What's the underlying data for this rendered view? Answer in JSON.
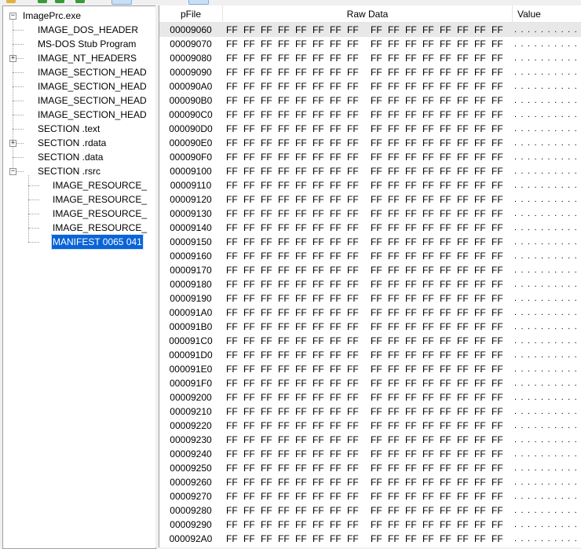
{
  "tree": {
    "root_label": "ImagePrc.exe",
    "nodes": [
      {
        "label": "IMAGE_DOS_HEADER",
        "level": 1,
        "expander": ""
      },
      {
        "label": "MS-DOS Stub Program",
        "level": 1,
        "expander": ""
      },
      {
        "label": "IMAGE_NT_HEADERS",
        "level": 1,
        "expander": "+"
      },
      {
        "label": "IMAGE_SECTION_HEAD",
        "level": 1,
        "expander": ""
      },
      {
        "label": "IMAGE_SECTION_HEAD",
        "level": 1,
        "expander": ""
      },
      {
        "label": "IMAGE_SECTION_HEAD",
        "level": 1,
        "expander": ""
      },
      {
        "label": "IMAGE_SECTION_HEAD",
        "level": 1,
        "expander": ""
      },
      {
        "label": "SECTION .text",
        "level": 1,
        "expander": ""
      },
      {
        "label": "SECTION .rdata",
        "level": 1,
        "expander": "+"
      },
      {
        "label": "SECTION .data",
        "level": 1,
        "expander": ""
      },
      {
        "label": "SECTION .rsrc",
        "level": 1,
        "expander": "-"
      },
      {
        "label": "IMAGE_RESOURCE_",
        "level": 2,
        "expander": ""
      },
      {
        "label": "IMAGE_RESOURCE_",
        "level": 2,
        "expander": ""
      },
      {
        "label": "IMAGE_RESOURCE_",
        "level": 2,
        "expander": ""
      },
      {
        "label": "IMAGE_RESOURCE_",
        "level": 2,
        "expander": ""
      },
      {
        "label": "MANIFEST  0065  041",
        "level": 2,
        "expander": "",
        "selected": true
      }
    ]
  },
  "grid": {
    "columns": [
      "pFile",
      "Raw Data",
      "Value"
    ],
    "byte_value": "FF",
    "value_text": ". . . . . . . . . .",
    "offsets": [
      "00009060",
      "00009070",
      "00009080",
      "00009090",
      "000090A0",
      "000090B0",
      "000090C0",
      "000090D0",
      "000090E0",
      "000090F0",
      "00009100",
      "00009110",
      "00009120",
      "00009130",
      "00009140",
      "00009150",
      "00009160",
      "00009170",
      "00009180",
      "00009190",
      "000091A0",
      "000091B0",
      "000091C0",
      "000091D0",
      "000091E0",
      "000091F0",
      "00009200",
      "00009210",
      "00009220",
      "00009230",
      "00009240",
      "00009250",
      "00009260",
      "00009270",
      "00009280",
      "00009290",
      "000092A0"
    ]
  }
}
